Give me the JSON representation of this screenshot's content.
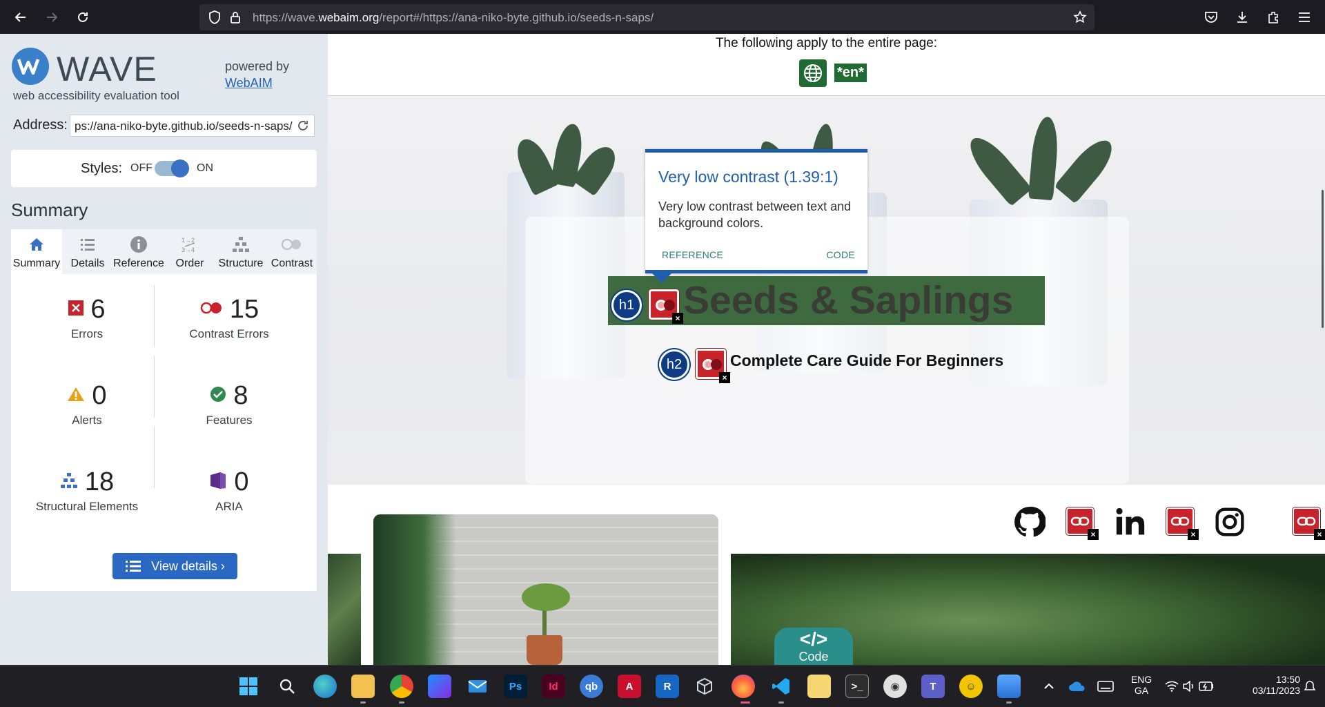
{
  "browser": {
    "url_prefix": "https://wave.",
    "url_domain": "webaim.org",
    "url_rest": "/report#/https://ana-niko-byte.github.io/seeds-n-saps/"
  },
  "wave": {
    "logo_text": "WAVE",
    "logo_sub": "web accessibility evaluation tool",
    "powered_by": "powered by",
    "powered_link": "WebAIM",
    "address_label": "Address:",
    "address_value": "ps://ana-niko-byte.github.io/seeds-n-saps/",
    "styles_label": "Styles:",
    "styles_off": "OFF",
    "styles_on": "ON",
    "summary_title": "Summary",
    "tabs": [
      {
        "label": "Summary",
        "icon": "home-icon",
        "active": true
      },
      {
        "label": "Details",
        "icon": "list-icon",
        "active": false
      },
      {
        "label": "Reference",
        "icon": "info-icon",
        "active": false
      },
      {
        "label": "Order",
        "icon": "order-icon",
        "active": false
      },
      {
        "label": "Structure",
        "icon": "structure-icon",
        "active": false
      },
      {
        "label": "Contrast",
        "icon": "contrast-icon",
        "active": false
      }
    ],
    "stats": {
      "errors": {
        "value": "6",
        "label": "Errors"
      },
      "contrast_errors": {
        "value": "15",
        "label": "Contrast Errors"
      },
      "alerts": {
        "value": "0",
        "label": "Alerts"
      },
      "features": {
        "value": "8",
        "label": "Features"
      },
      "structural": {
        "value": "18",
        "label": "Structural Elements"
      },
      "aria": {
        "value": "0",
        "label": "ARIA"
      }
    },
    "view_details": "View details ›"
  },
  "page": {
    "apply_text": "The following apply to the entire page:",
    "lang_tag": "*en*",
    "h1_badge": "h1",
    "h1_text": "Seeds & Saplings",
    "h2_badge": "h2",
    "h2_text": "Complete Care Guide For Beginners",
    "code_tab_symbol": "</>",
    "code_tab_label": "Code"
  },
  "tooltip": {
    "title": "Very low contrast (1.39:1)",
    "body": "Very low contrast between text and background colors.",
    "reference": "REFERENCE",
    "code": "CODE"
  },
  "taskbar": {
    "lang_top": "ENG",
    "lang_bottom": "GA",
    "time": "13:50",
    "date": "03/11/2023"
  },
  "colors": {
    "wave_blue": "#2a68c3",
    "error_red": "#c8222a",
    "feature_green": "#1f6b33",
    "tooltip_blue": "#1f5eaf"
  }
}
